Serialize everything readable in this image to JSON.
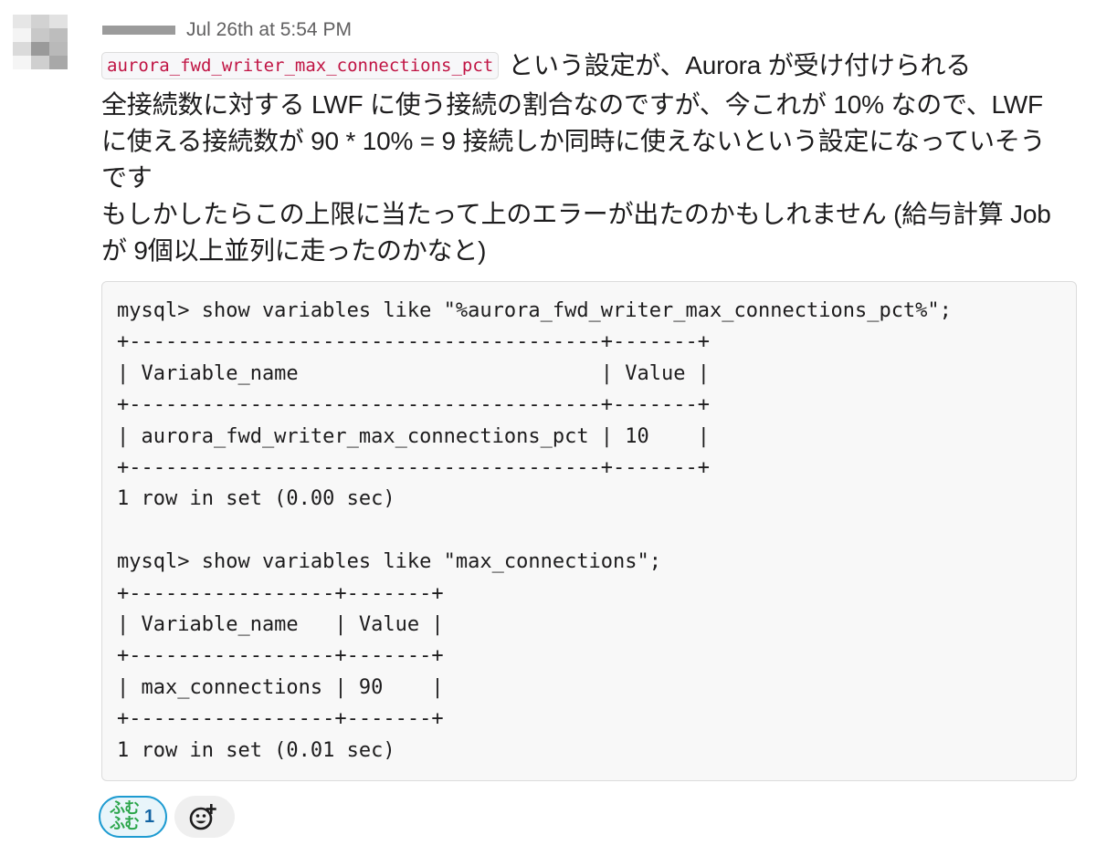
{
  "message": {
    "sender": "",
    "timestamp": "Jul 26th at 5:54 PM",
    "inline_code": "aurora_fwd_writer_max_connections_pct",
    "line1_rest": "という設定が、Aurora が受け付けられる",
    "line2": "全接続数に対する LWF に使う接続の割合なのですが、今これが 10% なので、LWF",
    "line3": "に使える接続数が 90 * 10% = 9 接続しか同時に使えないという設定になっていそう",
    "line4": "です",
    "line5": "もしかしたらこの上限に当たって上のエラーが出たのかもしれません (給与計算 Job",
    "line6": "が 9個以上並列に走ったのかなと)"
  },
  "code_block": {
    "content": "mysql> show variables like \"%aurora_fwd_writer_max_connections_pct%\";\n+---------------------------------------+-------+\n| Variable_name                         | Value |\n+---------------------------------------+-------+\n| aurora_fwd_writer_max_connections_pct | 10    |\n+---------------------------------------+-------+\n1 row in set (0.00 sec)\n\nmysql> show variables like \"max_connections\";\n+-----------------+-------+\n| Variable_name   | Value |\n+-----------------+-------+\n| max_connections | 90    |\n+-----------------+-------+\n1 row in set (0.01 sec)"
  },
  "reactions": [
    {
      "emoji_text": "ふむ\nふむ",
      "emoji_top": "ふむ",
      "emoji_bottom": "ふむ",
      "count": "1",
      "icon": "fumu-fumu-emoji"
    }
  ],
  "add_reaction": {
    "icon": "add-reaction-icon"
  },
  "colors": {
    "accent": "#1d9bd1",
    "inline_code_text": "#c01343",
    "code_background": "#f8f8f8",
    "timestamp": "#616061"
  }
}
